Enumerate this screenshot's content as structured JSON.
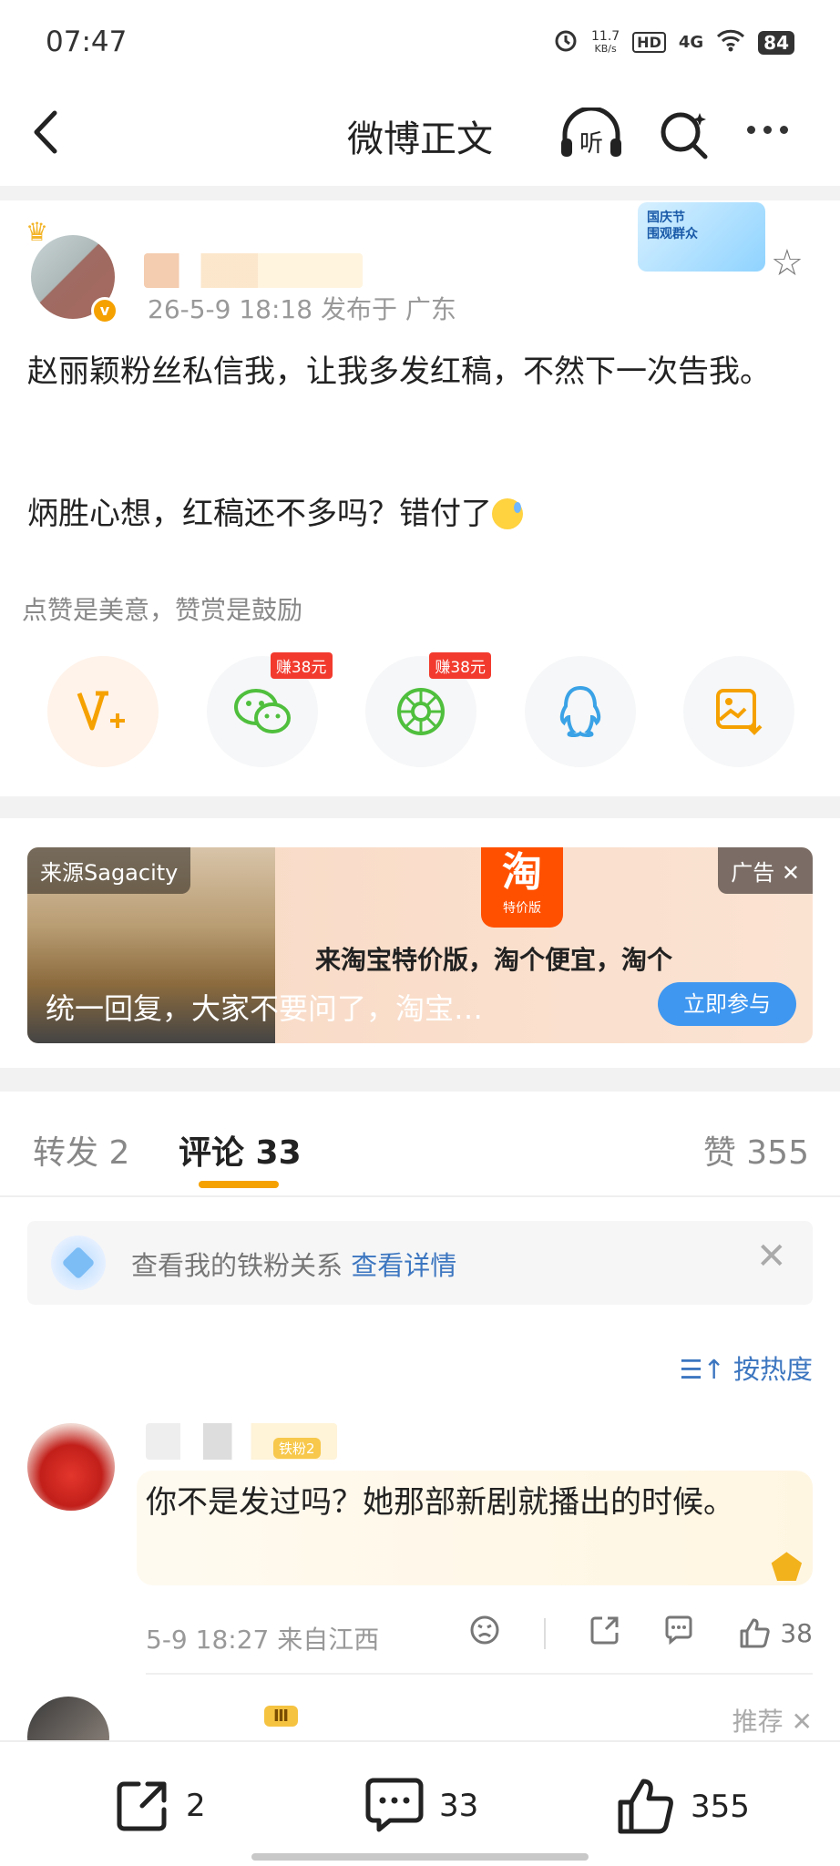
{
  "status_bar": {
    "time": "07:47",
    "speed": "11.7",
    "speed_unit": "KB/s",
    "hd": "HD",
    "network": "4G",
    "battery": "84"
  },
  "nav": {
    "title": "微博正文",
    "listen_label": "听"
  },
  "post": {
    "meta": "26-5-9 18:18  发布于 广东",
    "festival_badge": "国庆节\n围观群众",
    "text_line1": "赵丽颖粉丝私信我，让我多发红稿，不然下一次告我。",
    "text_line2": "炳胜心想，红稿还不多吗？错付了",
    "reward_tip": "点赞是美意，赞赏是鼓励",
    "share_badges": [
      "赚38元",
      "赚38元"
    ]
  },
  "ad": {
    "source": "来源Sagacity",
    "logo_big": "淘",
    "logo_small": "特价版",
    "tag": "广告",
    "headline": "来淘宝特价版，淘个便宜，淘个",
    "overlay": "统一回复，大家不要问了，淘宝…",
    "cta": "立即参与"
  },
  "tabs": {
    "repost": "转发 2",
    "comments": "评论 33",
    "likes": "赞 355"
  },
  "fan_bar": {
    "text": "查看我的铁粉关系",
    "link": "查看详情"
  },
  "sort_label": "按热度",
  "comment": {
    "badge": "铁粉2",
    "text": "你不是发过吗？她那部新剧就播出的时候。",
    "meta": "5-9 18:27  来自江西",
    "likes": "38"
  },
  "comment2": {
    "badge": "Ⅲ",
    "recommend": "推荐"
  },
  "bottom_bar": {
    "repost_count": "2",
    "comment_count": "33",
    "like_count": "355"
  },
  "colors": {
    "accent": "#f5a100",
    "link": "#3c76c0",
    "earn_badge": "#f23b2e",
    "wechat_green": "#4fbf3d",
    "qq_blue": "#3aa2e6"
  }
}
